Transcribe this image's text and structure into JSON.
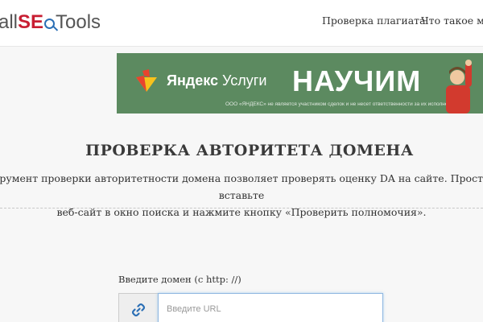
{
  "header": {
    "logo": {
      "prefix": "all",
      "seo": "SE",
      "suffix": "Tools"
    },
    "nav": [
      {
        "label": "Проверка плагиата"
      },
      {
        "label": "Что такое мой"
      }
    ]
  },
  "banner": {
    "brand": "Яндекс",
    "service": "Услуги",
    "cta": "НАУЧИМ",
    "disclaimer": "ООО «ЯНДЕКС» не является участником сделок и не несет ответственности за их исполнение",
    "colors": {
      "background": "#5c8a60",
      "yandex_red": "#e8442e",
      "yandex_yellow": "#f7c21c"
    }
  },
  "main": {
    "title": "ПРОВЕРКА АВТОРИТЕТА ДОМЕНА",
    "description_line1": "трумент проверки авторитетности домена позволяет проверять оценку DA на сайте. Просто вставьте",
    "description_line2": "веб-сайт в окно поиска и нажмите кнопку «Проверить полномочия».",
    "domain_label": "Введите домен (с http: //)",
    "url_placeholder": "Введите URL",
    "link_icon": "link-icon"
  }
}
